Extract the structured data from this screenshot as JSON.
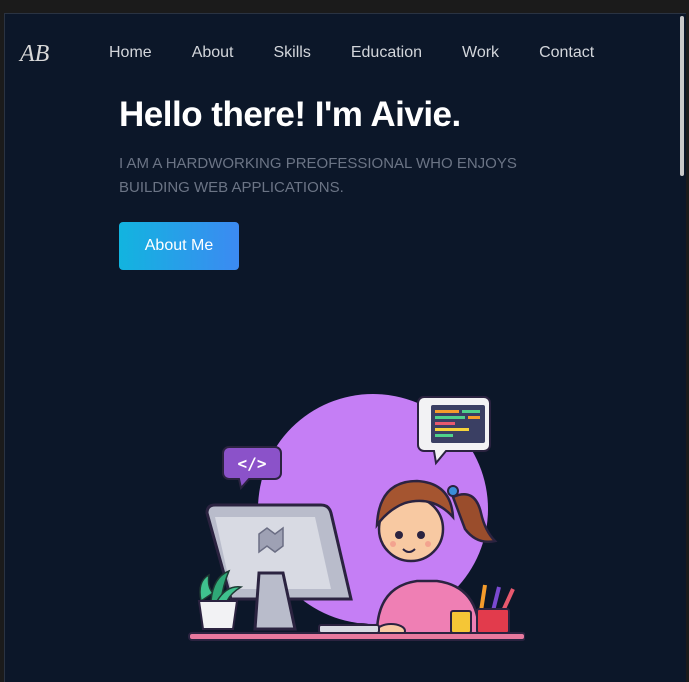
{
  "brand": {
    "logo_text": "AB"
  },
  "nav": {
    "items": [
      {
        "label": "Home"
      },
      {
        "label": "About"
      },
      {
        "label": "Skills"
      },
      {
        "label": "Education"
      },
      {
        "label": "Work"
      },
      {
        "label": "Contact"
      }
    ]
  },
  "hero": {
    "title": "Hello there! I'm Aivie.",
    "subtitle": "I am a hardworking preofessional who enjoys building web applications.",
    "cta_label": "About Me",
    "illustration_code_badge": "</>"
  },
  "colors": {
    "background": "#0c1729",
    "cta_gradient_start": "#12b4df",
    "cta_gradient_end": "#3c8af2",
    "accent_purple": "#c57ef5"
  }
}
